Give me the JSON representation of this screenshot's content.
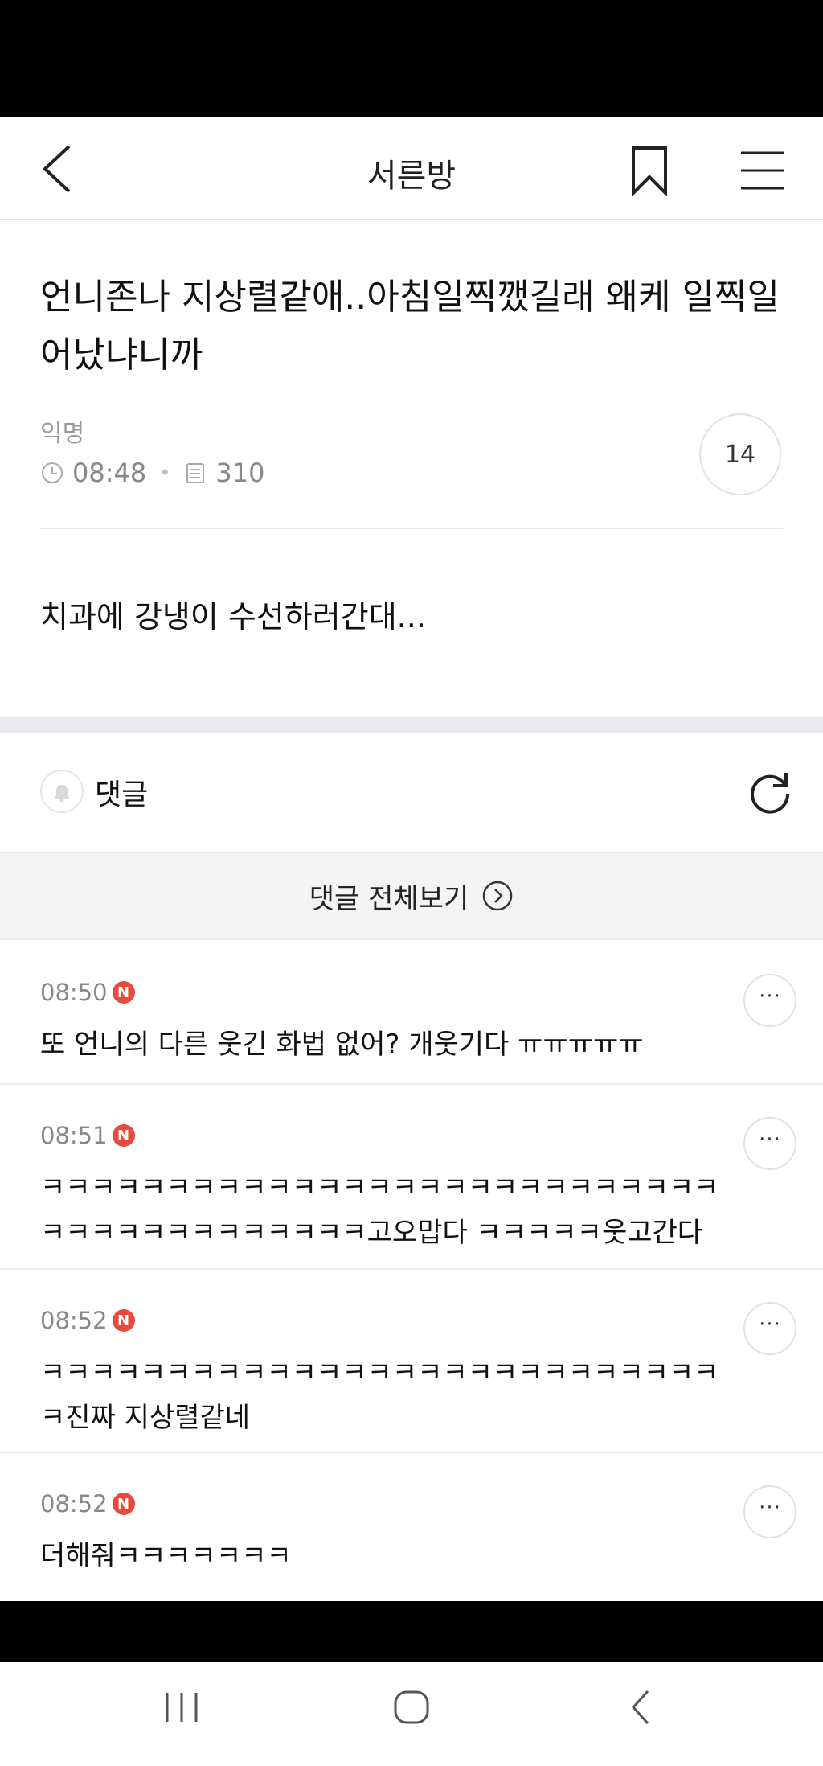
{
  "header": {
    "title": "서른방",
    "back_icon": "chevron-left-icon",
    "bookmark_icon": "bookmark-icon",
    "menu_icon": "hamburger-menu-icon"
  },
  "post": {
    "title": "언니존나 지상렬같애..아침일찍깼길래 왜케 일찍일어났냐니까",
    "author": "익명",
    "time": "08:48",
    "views": "310",
    "comment_count": "14",
    "body": "치과에 강냉이 수선하러간대..."
  },
  "comments_section": {
    "label": "댓글",
    "view_all_label": "댓글 전체보기",
    "new_badge": "N",
    "more_label": "···",
    "items": [
      {
        "time": "08:50",
        "text": "또 언니의 다른 웃긴 화법 없어? 개웃기다 ㅠㅠㅠㅠㅠ"
      },
      {
        "time": "08:51",
        "text": "ㅋㅋㅋㅋㅋㅋㅋㅋㅋㅋㅋㅋㅋㅋㅋㅋㅋㅋㅋㅋㅋㅋㅋㅋㅋㅋㅋㅋㅋㅋㅋㅋㅋㅋㅋㅋㅋㅋㅋㅋ고오맙다 ㅋㅋㅋㅋㅋ웃고간다"
      },
      {
        "time": "08:52",
        "text": "ㅋㅋㅋㅋㅋㅋㅋㅋㅋㅋㅋㅋㅋㅋㅋㅋㅋㅋㅋㅋㅋㅋㅋㅋㅋㅋㅋㅋ진짜 지상렬같네"
      },
      {
        "time": "08:52",
        "text": "더해줘ㅋㅋㅋㅋㅋㅋㅋ"
      }
    ]
  },
  "system_nav": {
    "recents_icon": "recents-icon",
    "home_icon": "home-icon",
    "back_icon": "back-icon"
  }
}
